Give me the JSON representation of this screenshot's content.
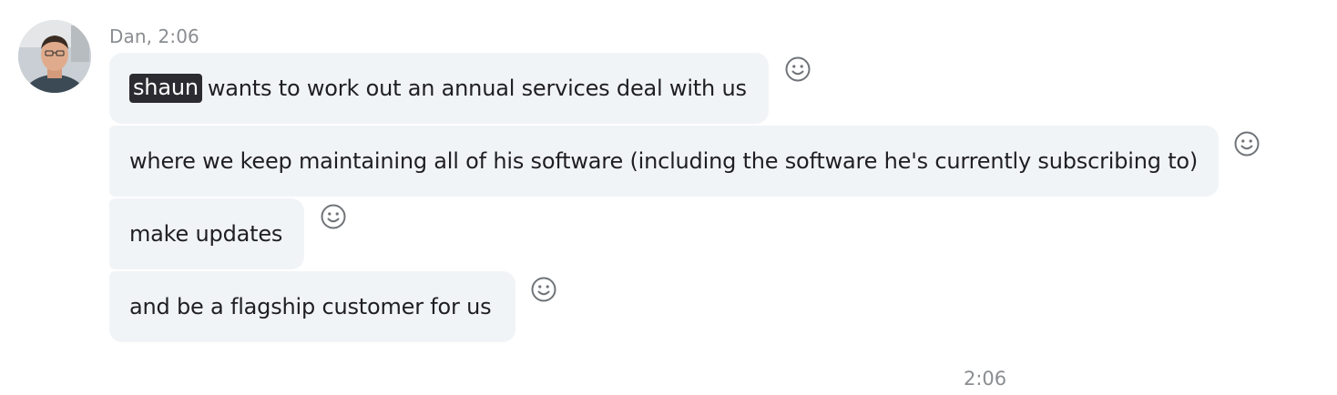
{
  "message": {
    "sender": "Dan",
    "time": "2:06",
    "meta_text": "Dan, 2:06",
    "mention": "shaun",
    "lines": [
      " wants to work out an annual services deal with us",
      "where we keep maintaining all of his software (including the software he's currently subscribing to)",
      "make updates",
      "and be a flagship customer for us"
    ]
  },
  "footer": {
    "timestamp": "2:06"
  },
  "icons": {
    "avatar": "avatar",
    "reaction": "smiley-icon"
  },
  "colors": {
    "bubble": "#f1f4f7",
    "mention_bg": "#2b2b31",
    "meta_text": "#8a8d91"
  }
}
